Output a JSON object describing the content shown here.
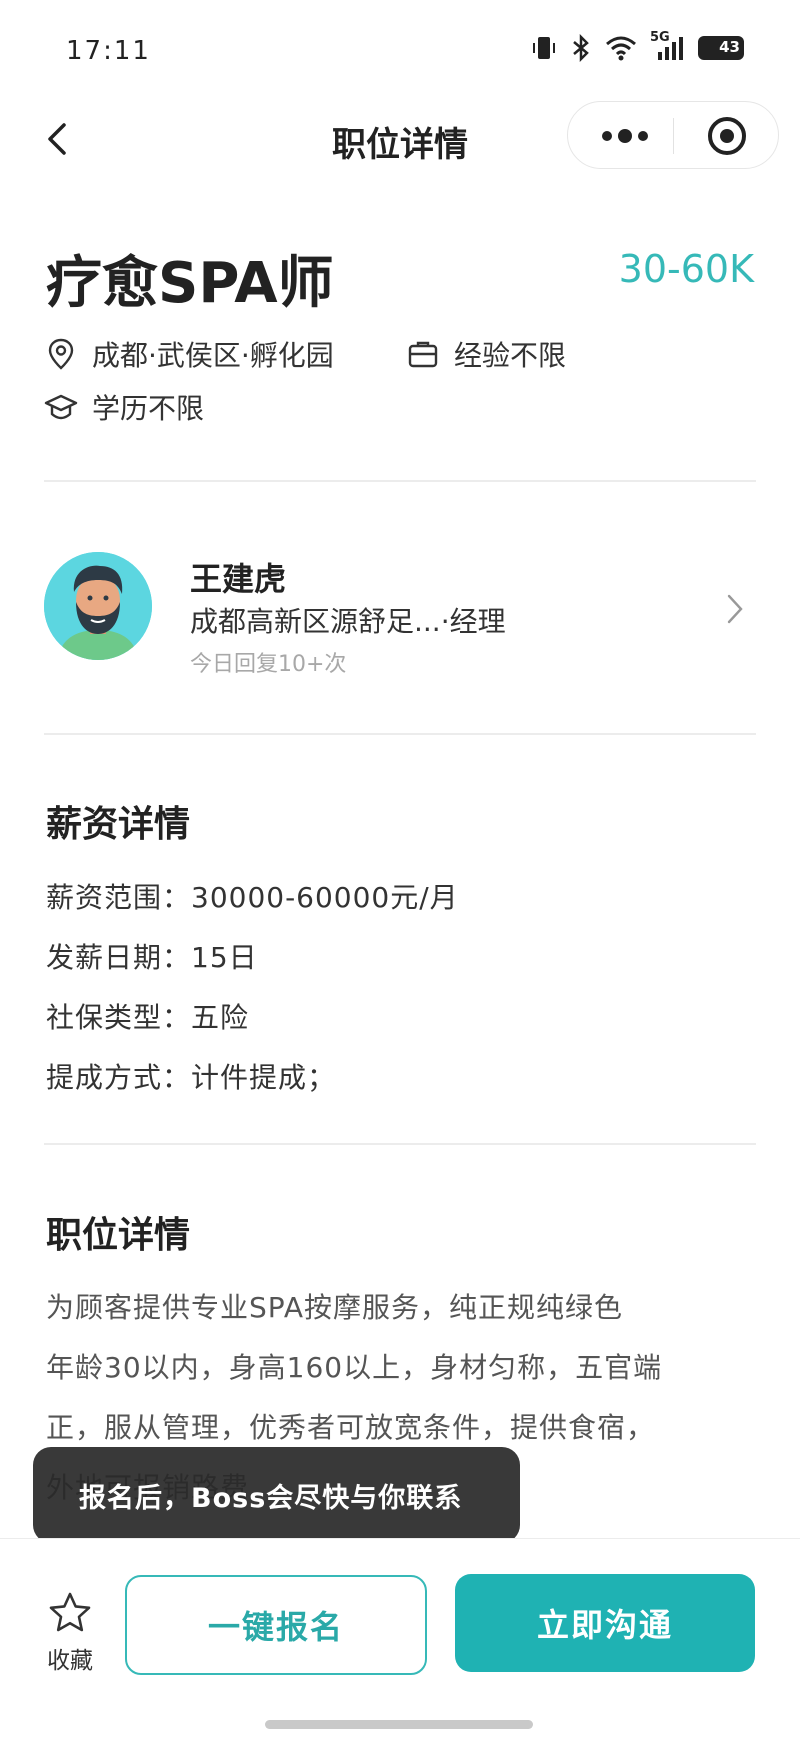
{
  "status_bar": {
    "time": "17:11",
    "network": "5G",
    "battery": "43"
  },
  "nav": {
    "title": "职位详情"
  },
  "job": {
    "title": "疗愈SPA师",
    "salary": "30-60K",
    "location": "成都·武侯区·孵化园",
    "experience": "经验不限",
    "education": "学历不限"
  },
  "recruiter": {
    "name": "王建虎",
    "company": "成都高新区源舒足...·经理",
    "reply": "今日回复10+次"
  },
  "salary_details": {
    "title": "薪资详情",
    "items": [
      {
        "text": "薪资范围：30000-60000元/月"
      },
      {
        "text": "发薪日期：15日"
      },
      {
        "text": "社保类型：五险"
      },
      {
        "text": "提成方式：计件提成；"
      }
    ]
  },
  "job_details": {
    "title": "职位详情",
    "lines": [
      "为顾客提供专业SPA按摩服务，纯正规纯绿色",
      "年龄30以内，身高160以上，身材匀称，五官端",
      "正，服从管理，优秀者可放宽条件，提供食宿，",
      "外地可报销路费"
    ]
  },
  "tooltip": {
    "text": "报名后，Boss会尽快与你联系"
  },
  "bottom_bar": {
    "favorite_label": "收藏",
    "apply_label": "一键报名",
    "chat_label": "立即沟通"
  },
  "colors": {
    "accent": "#1fb2b3",
    "salary": "#36b9b8",
    "tooltip_bg": "#282828"
  }
}
